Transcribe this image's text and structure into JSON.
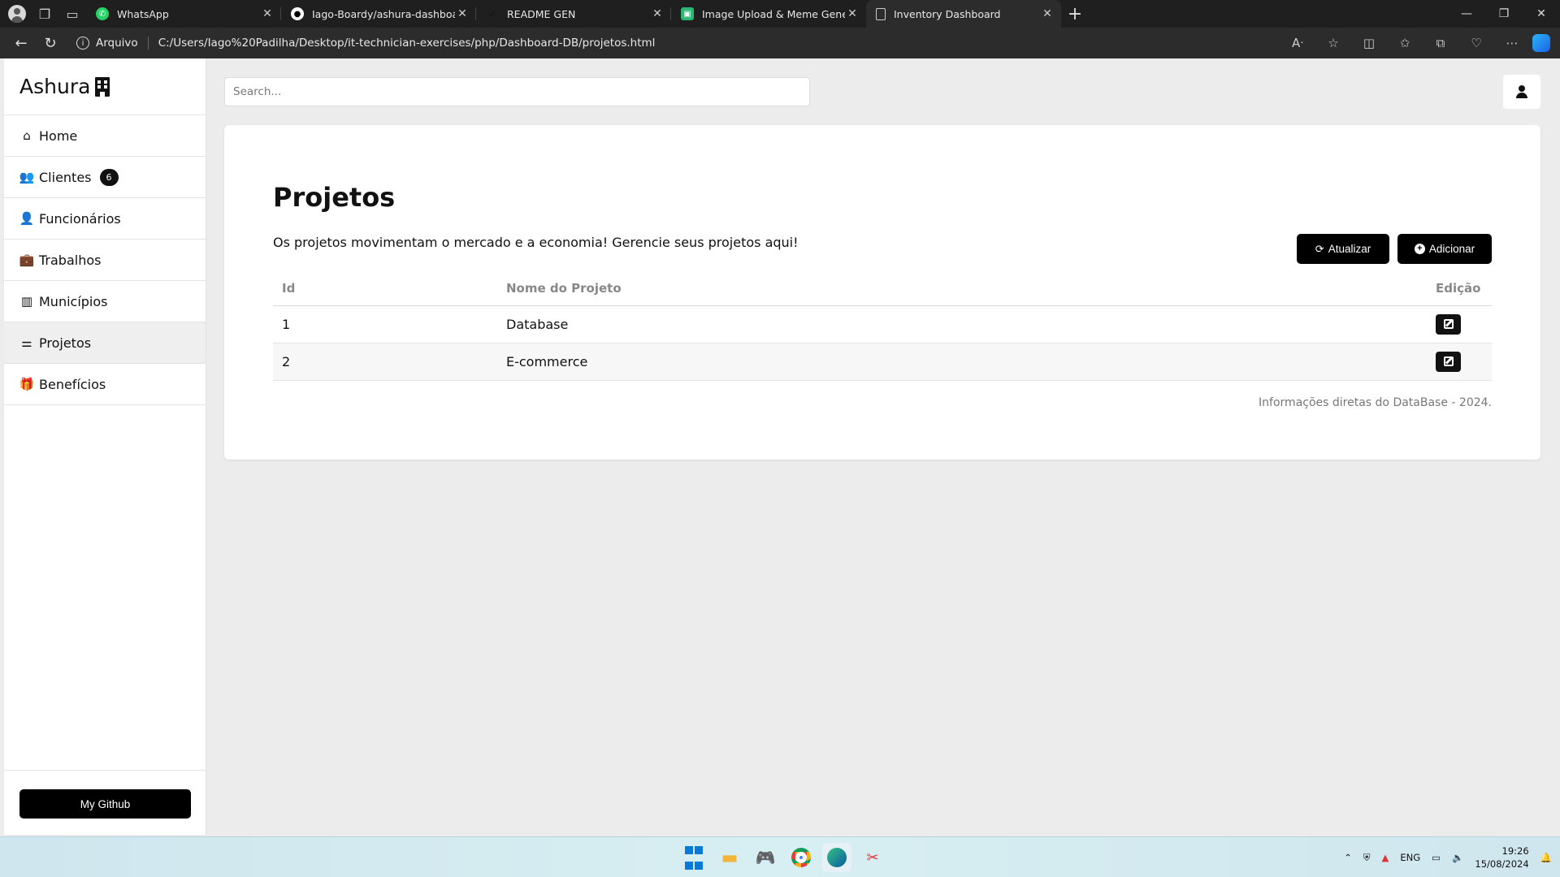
{
  "browser": {
    "tabs": [
      {
        "label": "WhatsApp",
        "icon": "whatsapp-icon",
        "color": "#25d366"
      },
      {
        "label": "Iago-Boardy/ashura-dashboard:",
        "icon": "github-icon",
        "color": "#ffffff"
      },
      {
        "label": "README GEN",
        "icon": "feather-icon",
        "color": "#222222"
      },
      {
        "label": "Image Upload & Meme Generati",
        "icon": "image-icon",
        "color": "#2bb673"
      },
      {
        "label": "Inventory Dashboard",
        "icon": "page-icon",
        "color": "#cccccc",
        "active": true
      }
    ],
    "scheme_label": "Arquivo",
    "url": "C:/Users/Iago%20Padilha/Desktop/it-technician-exercises/php/Dashboard-DB/projetos.html"
  },
  "sidebar": {
    "brand": "Ashura",
    "items": [
      {
        "label": "Home",
        "icon": "home-icon"
      },
      {
        "label": "Clientes",
        "icon": "users-icon",
        "badge": "6"
      },
      {
        "label": "Funcionários",
        "icon": "user-icon"
      },
      {
        "label": "Trabalhos",
        "icon": "briefcase-icon"
      },
      {
        "label": "Municípios",
        "icon": "city-icon"
      },
      {
        "label": "Projetos",
        "icon": "project-diagram-icon",
        "active": true
      },
      {
        "label": "Benefícios",
        "icon": "gift-icon"
      }
    ],
    "github_button": "My Github"
  },
  "search": {
    "placeholder": "Search..."
  },
  "main": {
    "title": "Projetos",
    "description": "Os projetos movimentam o mercado e a economia! Gerencie seus projetos aqui!",
    "refresh_label": "Atualizar",
    "add_label": "Adicionar",
    "table": {
      "headers": [
        "Id",
        "Nome do Projeto",
        "Edição"
      ],
      "rows": [
        {
          "id": "1",
          "name": "Database"
        },
        {
          "id": "2",
          "name": "E-commerce"
        }
      ]
    },
    "footnote": "Informações diretas do DataBase - 2024."
  },
  "taskbar": {
    "language": "ENG",
    "time": "19:26",
    "date": "15/08/2024"
  }
}
